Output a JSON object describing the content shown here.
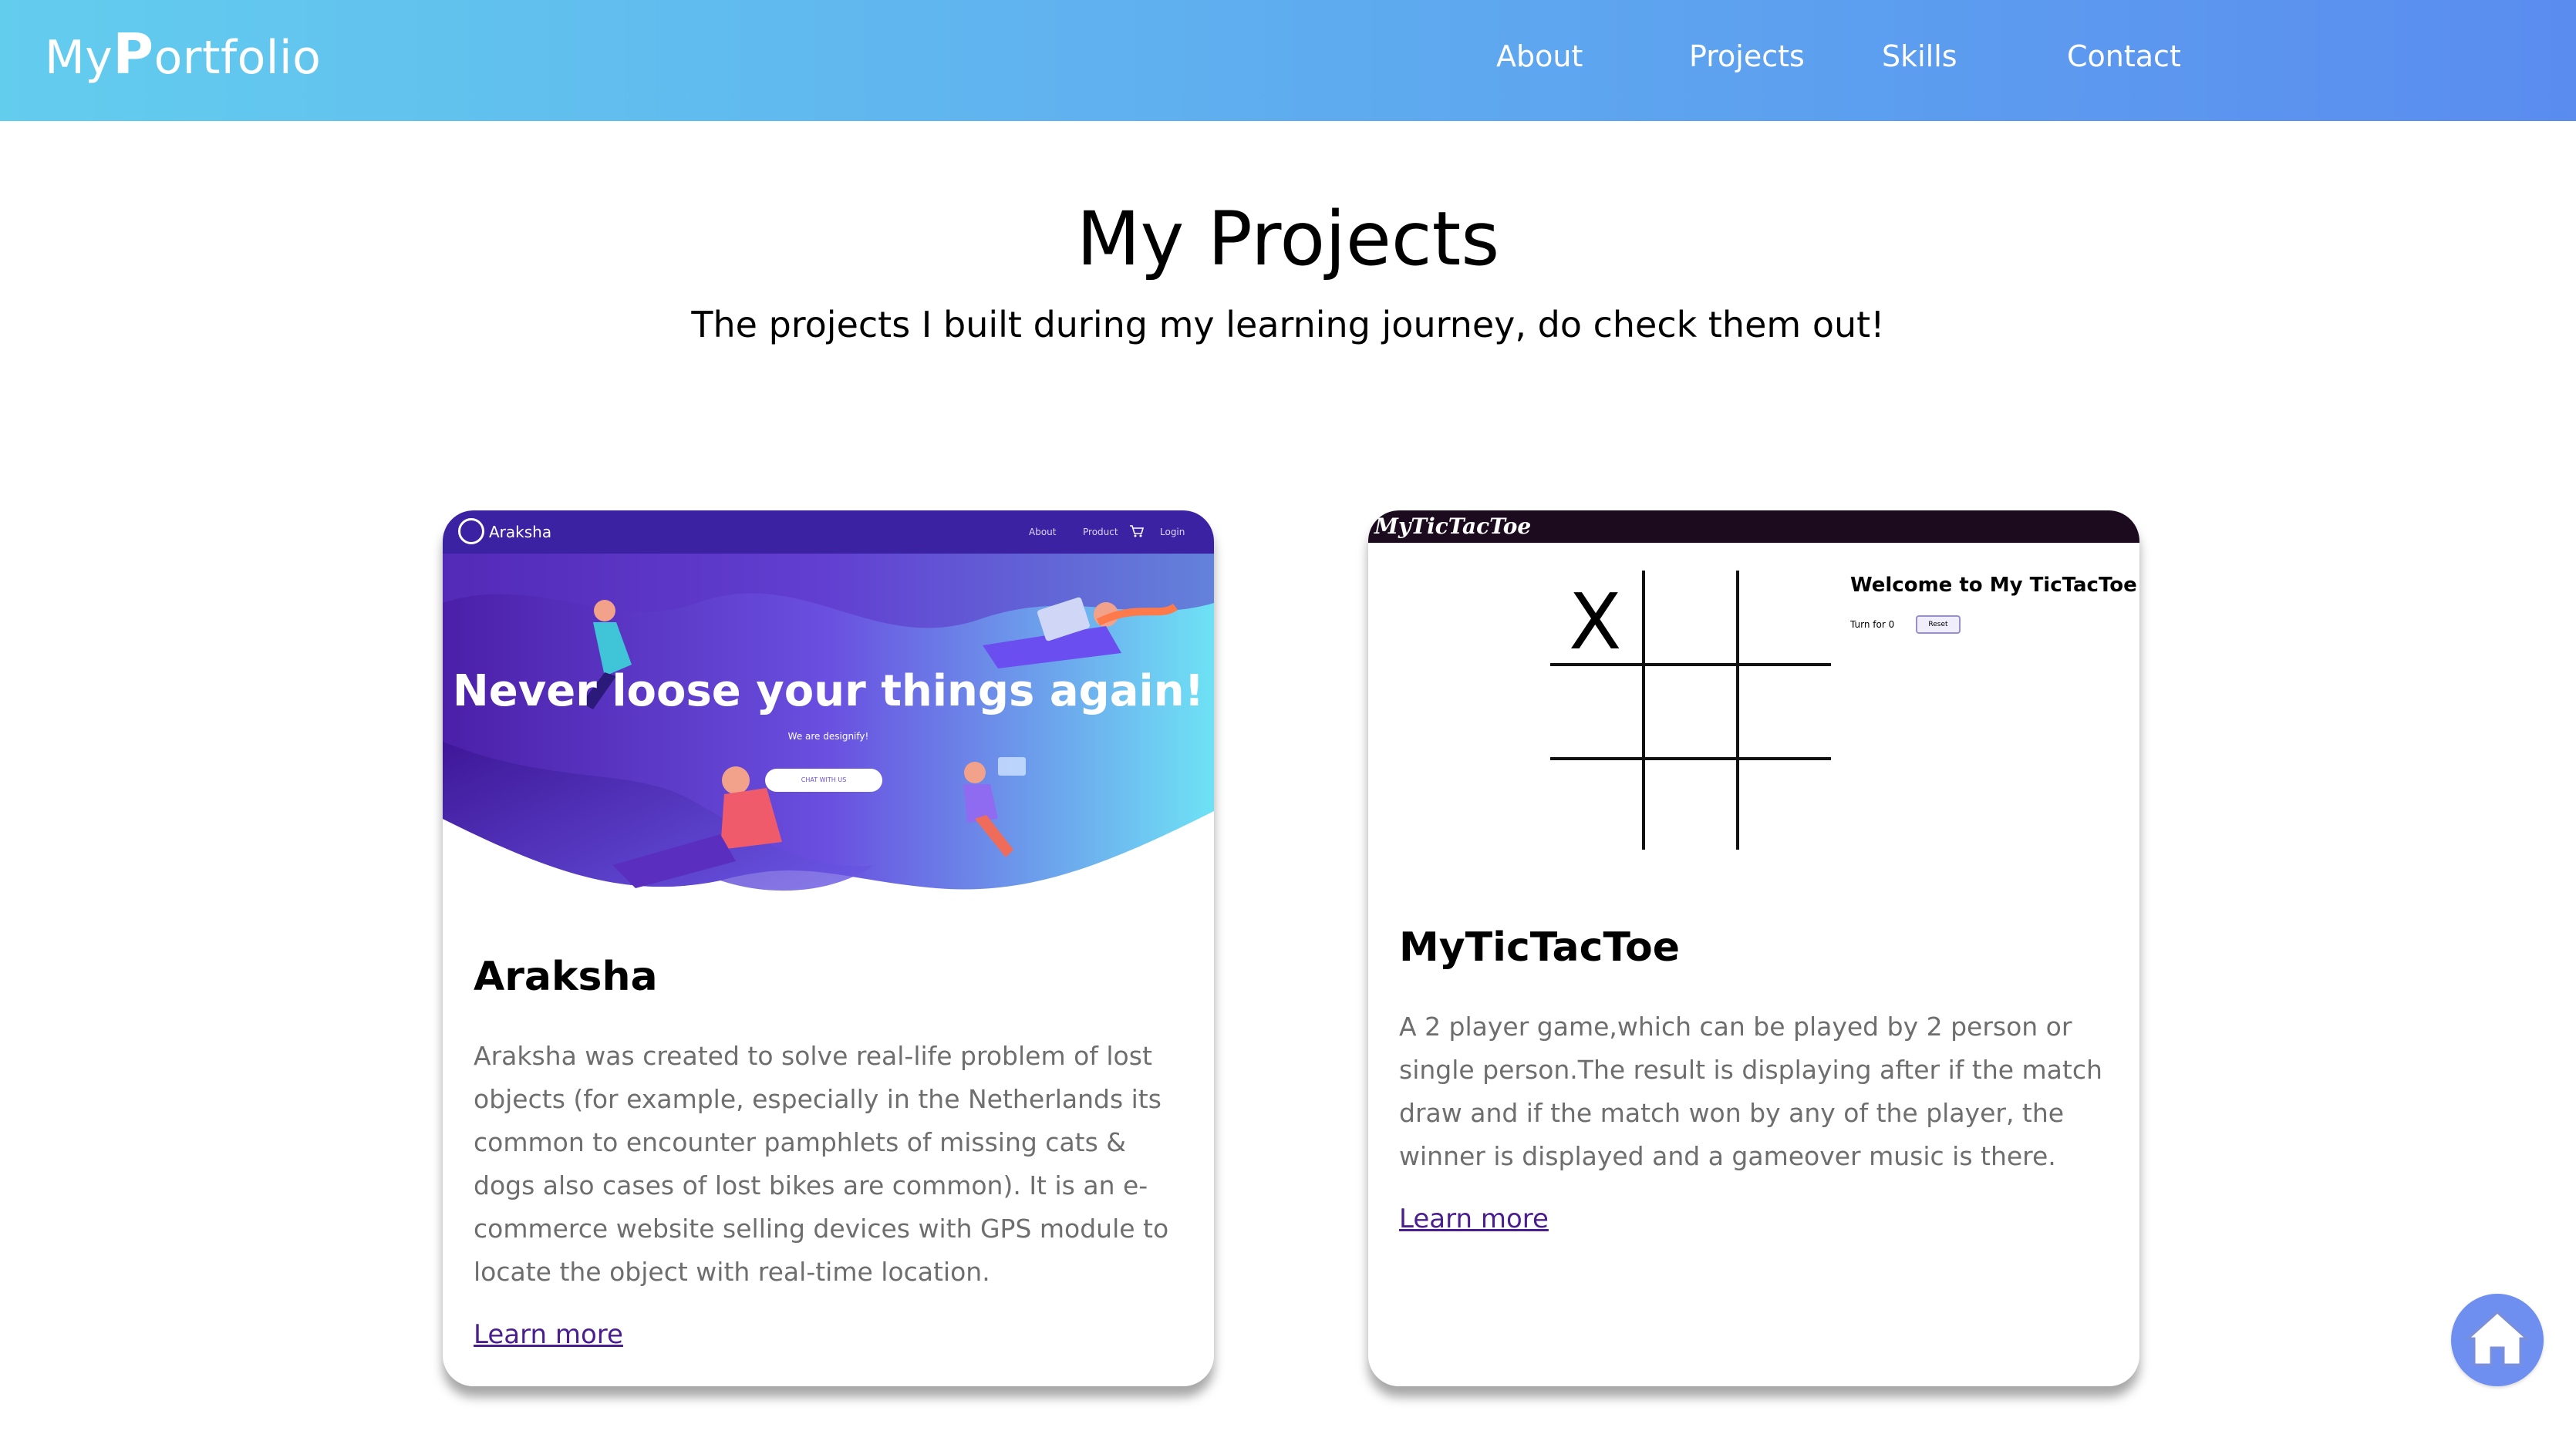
{
  "header": {
    "logo_prefix": "My",
    "logo_p": "P",
    "logo_suffix": "ortfolio",
    "nav": [
      "About",
      "Projects",
      "Skills",
      "Contact"
    ]
  },
  "section": {
    "title": "My Projects",
    "subtitle": "The projects I built during my learning journey, do check them out!"
  },
  "projects": [
    {
      "title": "Araksha",
      "description": "Araksha was created to solve real-life problem of lost objects (for example, especially in the Netherlands its common to encounter pamphlets of missing cats & dogs also cases of lost bikes are common). It is an e-commerce website selling devices with GPS module to locate the object with real-time location.",
      "link": "Learn more",
      "preview": {
        "brand": "Araksha",
        "nav": [
          "About",
          "Product",
          "Login"
        ],
        "hero_title": "Never loose your things again!",
        "hero_sub": "We are designify!",
        "cta": "CHAT WITH US"
      }
    },
    {
      "title": "MyTicTacToe",
      "description": "A 2 player game,which can be played by 2 person or single person.The result is displaying after if the match draw and if the match won by any of the player, the winner is displayed and a gameover music is there.",
      "link": "Learn more",
      "preview": {
        "brand": "MyTicTacToe",
        "welcome": "Welcome to My TicTacToe",
        "turn": "Turn for 0",
        "reset": "Reset",
        "mark": "X"
      }
    }
  ],
  "colors": {
    "header_start": "#63cdee",
    "header_end": "#5a8cef",
    "link": "#4b1e8f",
    "home_button": "#6f8ff0"
  },
  "icons": {
    "home": "home-icon",
    "cart": "cart-icon",
    "user": "user-icon"
  }
}
